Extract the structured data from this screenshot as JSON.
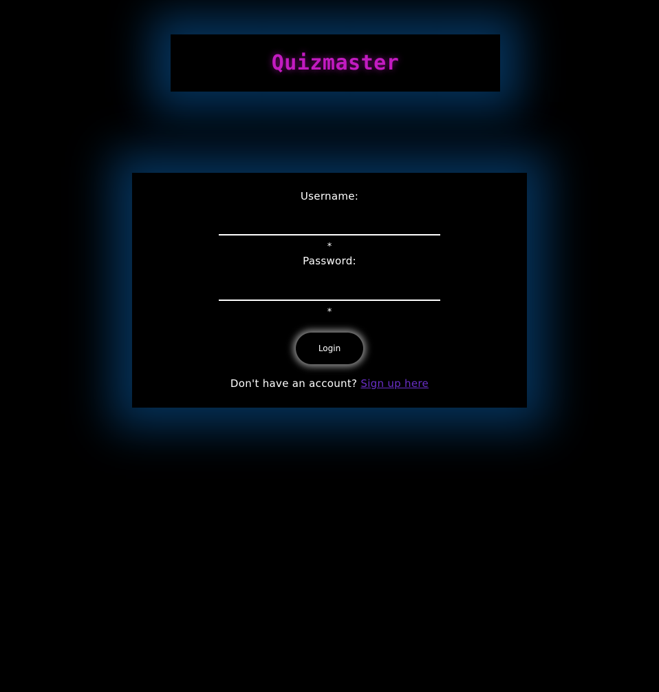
{
  "header": {
    "title": "Quizmaster"
  },
  "login_form": {
    "username_label": "Username:",
    "username_value": "",
    "username_required_mark": "*",
    "password_label": "Password:",
    "password_value": "",
    "password_required_mark": "*",
    "submit_label": "Login"
  },
  "signup": {
    "prompt": "Don't have an account?",
    "link_text": "Sign up here"
  },
  "colors": {
    "background": "#000000",
    "title": "#c21bc0",
    "glow": "#0a5aa0",
    "link": "#6a2fc9",
    "text": "#ffffff"
  }
}
